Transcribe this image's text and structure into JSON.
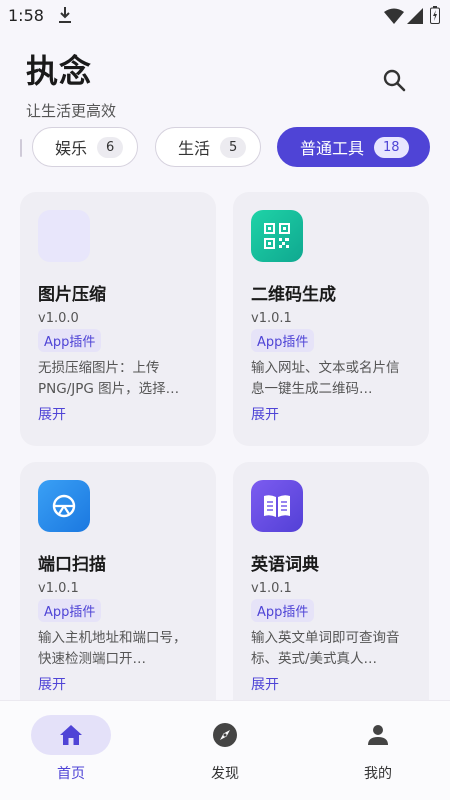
{
  "status_bar": {
    "time": "1:58",
    "icons": [
      "download-icon",
      "wifi-icon",
      "signal-icon",
      "battery-icon"
    ]
  },
  "header": {
    "title": "执念",
    "subtitle": "让生活更高效",
    "search_icon": "search-icon"
  },
  "categories": [
    {
      "label": "娱乐",
      "count": "6",
      "active": false
    },
    {
      "label": "生活",
      "count": "5",
      "active": false
    },
    {
      "label": "普通工具",
      "count": "18",
      "active": true
    }
  ],
  "cards": [
    {
      "title": "图片压缩",
      "version": "v1.0.0",
      "tag": "App插件",
      "description": "无损压缩图片：上传PNG/JPG 图片，选择…",
      "expand": "展开",
      "icon": "placeholder-icon"
    },
    {
      "title": "二维码生成",
      "version": "v1.0.1",
      "tag": "App插件",
      "description": "输入网址、文本或名片信息一键生成二维码…",
      "expand": "展开",
      "icon": "qr-code-icon"
    },
    {
      "title": "端口扫描",
      "version": "v1.0.1",
      "tag": "App插件",
      "description": "输入主机地址和端口号，快速检测端口开…",
      "expand": "展开",
      "icon": "port-scan-icon"
    },
    {
      "title": "英语词典",
      "version": "v1.0.1",
      "tag": "App插件",
      "description": "输入英文单词即可查询音标、英式/美式真人…",
      "expand": "展开",
      "icon": "book-icon"
    }
  ],
  "bottom_nav": [
    {
      "label": "首页",
      "icon": "home-icon",
      "active": true
    },
    {
      "label": "发现",
      "icon": "compass-icon",
      "active": false
    },
    {
      "label": "我的",
      "icon": "person-icon",
      "active": false
    }
  ],
  "colors": {
    "accent": "#4f44d6",
    "background": "#f7f6fb",
    "card": "#efeef4"
  }
}
